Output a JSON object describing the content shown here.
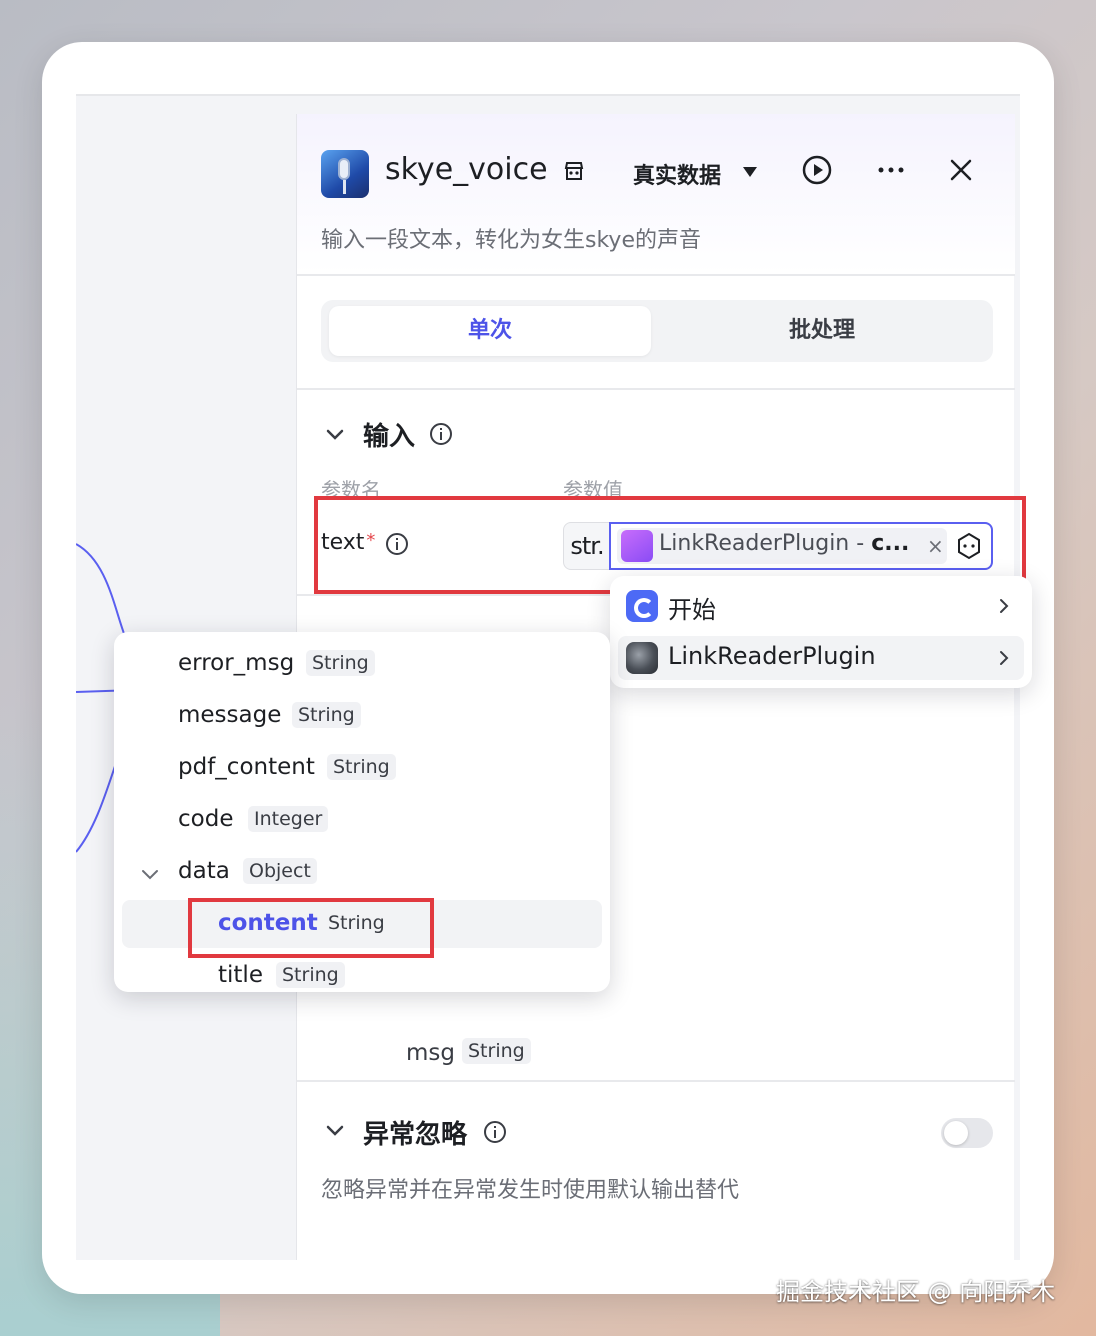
{
  "panel": {
    "plugin_name": "skye_voice",
    "mode_label": "真实数据",
    "description": "输入一段文本，转化为女生skye的声音"
  },
  "tabs": [
    {
      "label": "单次",
      "active": true
    },
    {
      "label": "批处理",
      "active": false
    }
  ],
  "input_section": {
    "title": "输入",
    "col_name": "参数名",
    "col_value": "参数值",
    "param": {
      "name": "text",
      "required_mark": "*",
      "type_badge": "str.",
      "ref_tag_prefix": "LinkReaderPlugin - ",
      "ref_tag_suffix": "c...",
      "tag_close": "×"
    }
  },
  "node_menu": {
    "items": [
      {
        "label": "开始",
        "icon": "start-node-icon"
      },
      {
        "label": "LinkReaderPlugin",
        "icon": "plugin-node-icon"
      }
    ]
  },
  "field_menu": {
    "fields": [
      {
        "name": "error_msg",
        "type": "String"
      },
      {
        "name": "message",
        "type": "String"
      },
      {
        "name": "pdf_content",
        "type": "String"
      },
      {
        "name": "code",
        "type": "Integer"
      },
      {
        "name": "data",
        "type": "Object"
      },
      {
        "name": "content",
        "type": "String"
      },
      {
        "name": "title",
        "type": "String"
      }
    ]
  },
  "output_field": {
    "name": "msg",
    "type": "String"
  },
  "ignore_section": {
    "title": "异常忽略",
    "description": "忽略异常并在异常发生时使用默认输出替代",
    "enabled": false
  },
  "watermark": "掘金技术社区 @ 向阳乔木",
  "colors": {
    "accent": "#4d53e8",
    "highlight": "#e1393f",
    "wire": "#5a5ff0"
  }
}
